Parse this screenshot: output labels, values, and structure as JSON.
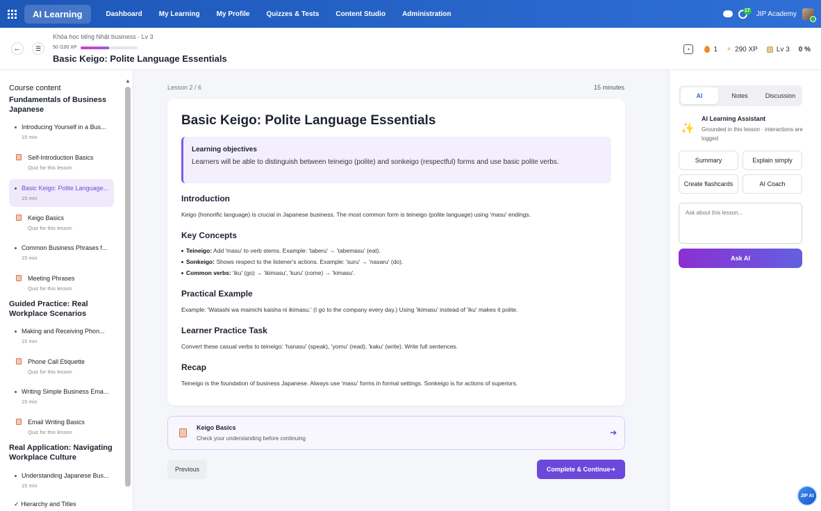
{
  "topnav": {
    "brand": "AI Learning",
    "links": [
      "Dashboard",
      "My Learning",
      "My Profile",
      "Quizzes & Tests",
      "Content Studio",
      "Administration"
    ],
    "notif_count": "17",
    "account": "JIP Academy"
  },
  "header": {
    "breadcrumb": "Khóa học tiếng Nhật business · Lv 3",
    "xp_text": "50 /100 XP",
    "xp_progress": 0.5,
    "title": "Basic Keigo: Polite Language Essentials",
    "streak": "1",
    "xp_total": "290 XP",
    "level": "Lv 3",
    "percent": "0 %"
  },
  "sidebar": {
    "title": "Course content",
    "sections": [
      "Fundamentals of Business Japanese",
      "Guided Practice: Real Workplace Scenarios",
      "Real Application: Navigating Workplace Culture"
    ],
    "items": [
      {
        "label": "Introducing Yourself in a Bus...",
        "sub": "15 min",
        "type": "lesson"
      },
      {
        "label": "Self-Introduction Basics",
        "sub": "Quiz for this lesson",
        "type": "quiz"
      },
      {
        "label": "Basic Keigo: Polite Language...",
        "sub": "15 min",
        "type": "lesson",
        "active": true
      },
      {
        "label": "Keigo Basics",
        "sub": "Quiz for this lesson",
        "type": "quiz"
      },
      {
        "label": "Common Business Phrases f...",
        "sub": "15 min",
        "type": "lesson"
      },
      {
        "label": "Meeting Phrases",
        "sub": "Quiz for this lesson",
        "type": "quiz"
      },
      {
        "label": "Making and Receiving Phon...",
        "sub": "15 min",
        "type": "lesson"
      },
      {
        "label": "Phone Call Etiquette",
        "sub": "Quiz for this lesson",
        "type": "quiz"
      },
      {
        "label": "Writing Simple Business Ema...",
        "sub": "15 min",
        "type": "lesson"
      },
      {
        "label": "Email Writing Basics",
        "sub": "Quiz for this lesson",
        "type": "quiz"
      },
      {
        "label": "Understanding Japanese Bus...",
        "sub": "15 min",
        "type": "lesson"
      }
    ],
    "last_item": "Hierarchy and Titles"
  },
  "main": {
    "lesson_num": "Lesson 2 / 6",
    "duration": "15 minutes",
    "card_title": "Basic Keigo: Polite Language Essentials",
    "objectives_title": "Learning objectives",
    "objectives_text": "Learners will be able to distinguish between teineigo (polite) and sonkeigo (respectful) forms and use basic polite verbs.",
    "intro_h": "Introduction",
    "intro_p": "Keigo (honorific language) is crucial in Japanese business. The most common form is teineigo (polite language) using 'masu' endings.",
    "concepts_h": "Key Concepts",
    "concepts": [
      {
        "term": "Teineigo:",
        "text": " Add 'masu' to verb stems. Example: 'taberu' → 'tabemasu' (eat)."
      },
      {
        "term": "Sonkeigo:",
        "text": " Shows respect to the listener's actions. Example: 'suru' → 'nasaru' (do)."
      },
      {
        "term": "Common verbs:",
        "text": " 'iku' (go) → 'ikimasu', 'kuru' (come) → 'kimasu'."
      }
    ],
    "example_h": "Practical Example",
    "example_p": "Example: 'Watashi wa mainichi kaisha ni ikimasu.' (I go to the company every day.) Using 'ikimasu' instead of 'iku' makes it polite.",
    "task_h": "Learner Practice Task",
    "task_p": "Convert these casual verbs to teineigo: 'hanasu' (speak), 'yomu' (read), 'kaku' (write). Write full sentences.",
    "recap_h": "Recap",
    "recap_p": "Teineigo is the foundation of business Japanese. Always use 'masu' forms in formal settings. Sonkeigo is for actions of superiors.",
    "quiz_title": "Keigo Basics",
    "quiz_sub": "Check your understanding before continuing",
    "prev_label": "Previous",
    "next_label": "Complete & Continue"
  },
  "rpanel": {
    "tabs": [
      "AI",
      "Notes",
      "Discussion"
    ],
    "assistant_title": "AI Learning Assistant",
    "assistant_sub": "Grounded in this lesson · interactions are logged",
    "actions": [
      "Summary",
      "Explain simply",
      "Create flashcards",
      "AI Coach"
    ],
    "ask_placeholder": "Ask about this lesson...",
    "ask_button": "Ask AI"
  },
  "fab_label": "JIP AI"
}
